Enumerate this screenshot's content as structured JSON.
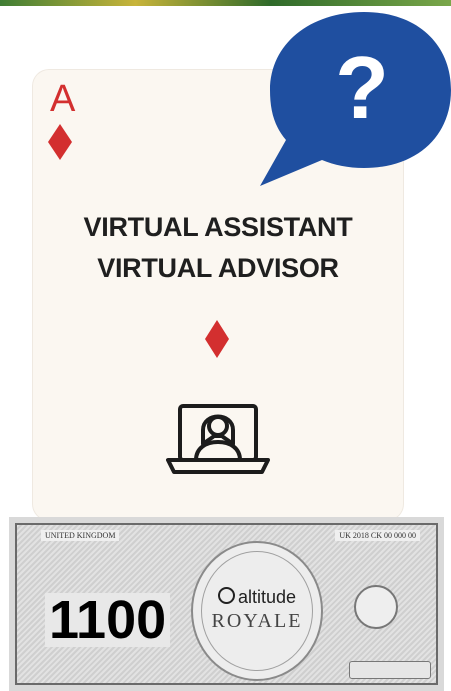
{
  "card": {
    "rank": "A",
    "suit": "diamond",
    "title_line1": "VIRTUAL ASSISTANT",
    "title_line2": "VIRTUAL ADVISOR",
    "help_icon": "question-speech-bubble-icon",
    "illustration": "person-on-laptop-icon",
    "colors": {
      "suit": "#d32f2f",
      "bubble": "#1f4fa0",
      "text": "#1f1f1f",
      "card_bg": "#fbf7f1"
    }
  },
  "banknote": {
    "country": "UNITED KINGDOM",
    "serial": "UK 2018 CK 00 000 00",
    "amount": "1100",
    "brand": "altitude",
    "brand_sub": "ROYALE"
  }
}
